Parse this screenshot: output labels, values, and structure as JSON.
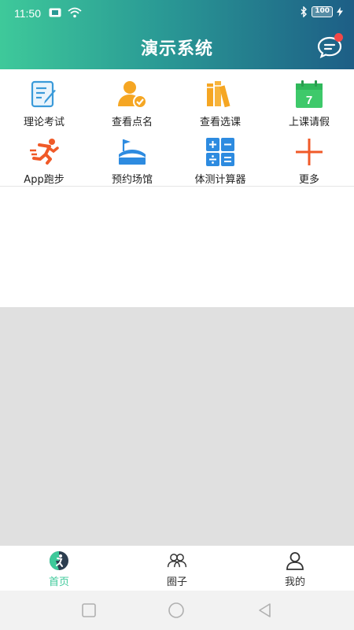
{
  "status_bar": {
    "time": "11:50",
    "battery": "100"
  },
  "header": {
    "title": "演示系统"
  },
  "grid": {
    "items": [
      {
        "label": "理论考试",
        "icon": "exam-document-icon"
      },
      {
        "label": "查看点名",
        "icon": "roll-call-user-icon"
      },
      {
        "label": "查看选课",
        "icon": "books-icon"
      },
      {
        "label": "上课请假",
        "icon": "calendar-icon"
      },
      {
        "label": "App跑步",
        "icon": "running-icon"
      },
      {
        "label": "预约场馆",
        "icon": "stadium-icon"
      },
      {
        "label": "体测计算器",
        "icon": "calculator-icon"
      },
      {
        "label": "更多",
        "icon": "plus-icon"
      }
    ]
  },
  "calendar_day": "7",
  "tabbar": {
    "tabs": [
      {
        "label": "首页",
        "active": true
      },
      {
        "label": "圈子",
        "active": false
      },
      {
        "label": "我的",
        "active": false
      }
    ]
  },
  "colors": {
    "accent": "#3ec99a",
    "header_end": "#1d5e86",
    "badge": "#f24848"
  }
}
